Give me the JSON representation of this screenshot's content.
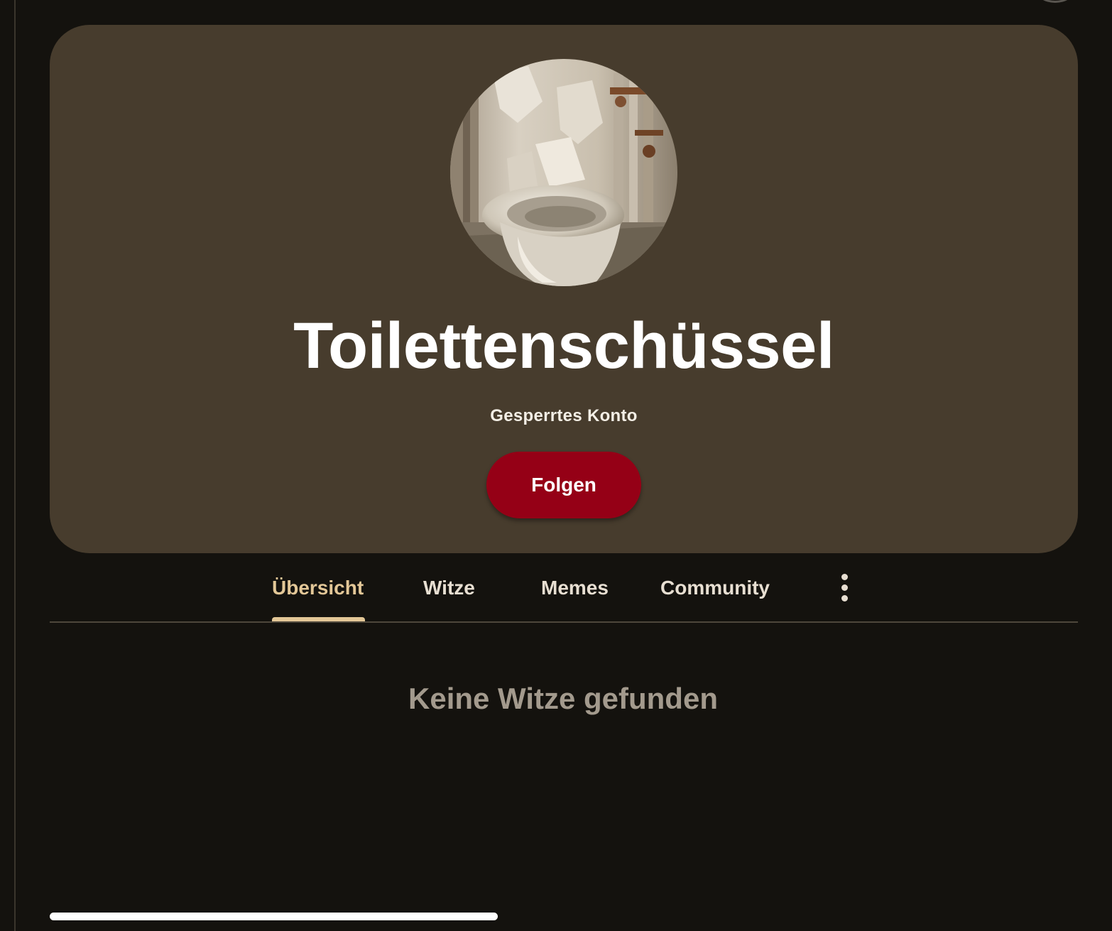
{
  "profile": {
    "name": "Toilettenschüssel",
    "status": "Gesperrtes Konto",
    "follow_label": "Folgen"
  },
  "tabs": [
    {
      "label": "Übersicht",
      "active": true
    },
    {
      "label": "Witze",
      "active": false
    },
    {
      "label": "Memes",
      "active": false
    },
    {
      "label": "Community",
      "active": false
    }
  ],
  "more_icon": "more-vertical-icon",
  "content": {
    "empty_message": "Keine Witze gefunden"
  },
  "colors": {
    "background": "#14120e",
    "card": "#473c2d",
    "accent": "#e3c797",
    "follow_button": "#950016",
    "muted_text": "#a39a8d"
  }
}
